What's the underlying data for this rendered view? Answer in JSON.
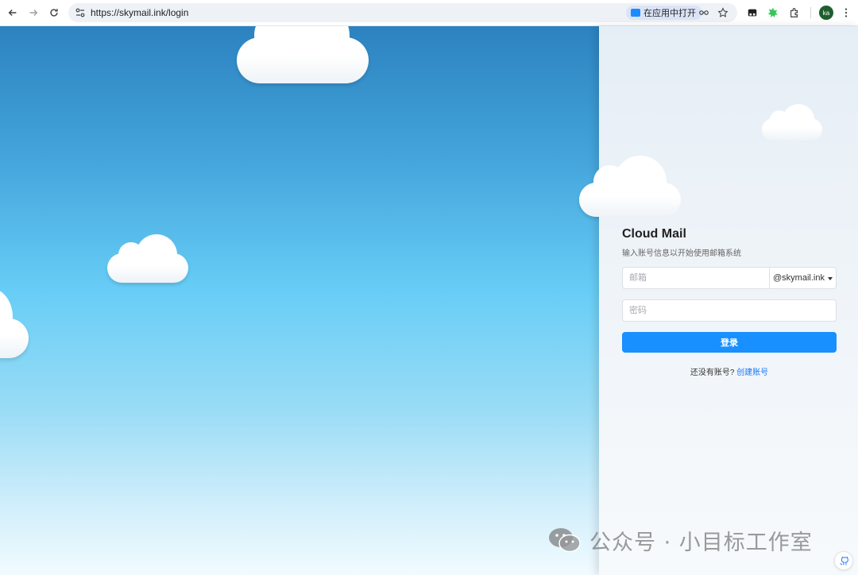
{
  "browser": {
    "url": "https://skymail.ink/login",
    "open_in_app": "在应用中打开",
    "avatar_initials": "ka",
    "icons": [
      "back-icon",
      "forward-icon",
      "reload-icon",
      "site-info-icon",
      "password-key-icon",
      "bookmark-star-icon",
      "extension-icon",
      "puzzle-icon",
      "menu-icon"
    ]
  },
  "login": {
    "title": "Cloud Mail",
    "subtitle": "输入账号信息以开始使用邮箱系统",
    "email_placeholder": "邮箱",
    "domain": "@skymail.ink",
    "password_placeholder": "密码",
    "login_button": "登录",
    "no_account_text": "还没有账号? ",
    "create_account_link": "创建账号"
  },
  "watermark": {
    "text": "公众号 · 小目标工作室"
  },
  "colors": {
    "primary": "#1890ff",
    "link": "#1677ff",
    "sky_top": "#2c82bf",
    "sky_mid": "#67cdf6"
  }
}
